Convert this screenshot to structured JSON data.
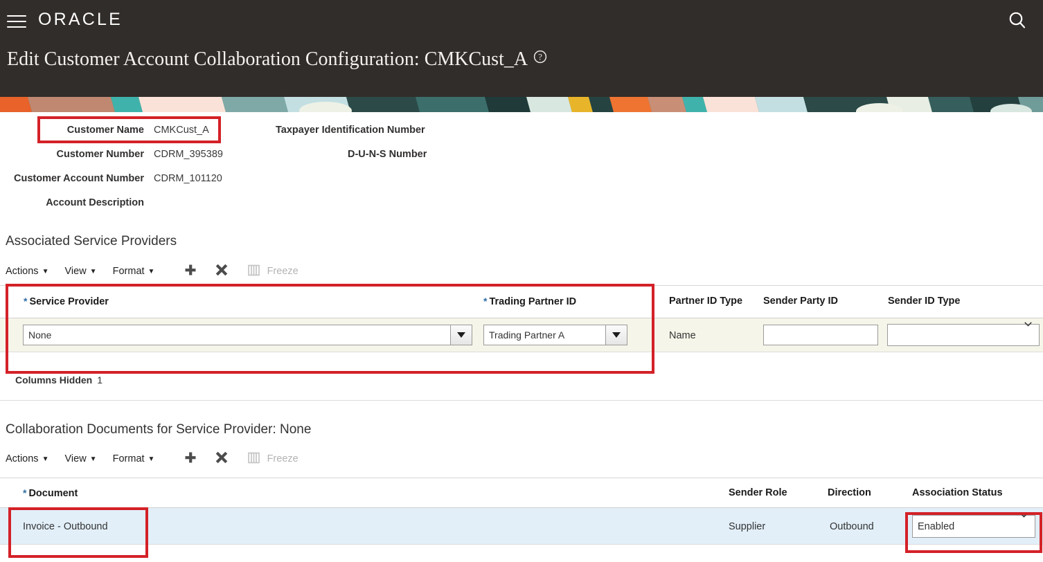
{
  "header": {
    "brand": "ORACLE",
    "menu_icon": "hamburger-icon",
    "search_icon": "search-icon",
    "title": "Edit Customer Account Collaboration Configuration: CMKCust_A",
    "help_icon": "help-circle-icon"
  },
  "summary": {
    "left": [
      {
        "label": "Customer Name",
        "value": "CMKCust_A"
      },
      {
        "label": "Customer Number",
        "value": "CDRM_395389"
      },
      {
        "label": "Customer Account Number",
        "value": "CDRM_101120"
      },
      {
        "label": "Account Description",
        "value": ""
      }
    ],
    "right": [
      {
        "label": "Taxpayer Identification Number",
        "value": ""
      },
      {
        "label": "D-U-N-S Number",
        "value": ""
      }
    ]
  },
  "providers_section": {
    "title": "Associated Service Providers",
    "toolbar": {
      "actions": "Actions",
      "view": "View",
      "format": "Format",
      "add_icon": "plus-icon",
      "delete_icon": "close-x-icon",
      "freeze_icon": "freeze-columns-icon",
      "freeze_label": "Freeze"
    },
    "columns": [
      {
        "label": "Service Provider",
        "required": true
      },
      {
        "label": "Trading Partner ID",
        "required": true
      },
      {
        "label": "Partner ID Type",
        "required": false
      },
      {
        "label": "Sender Party ID",
        "required": false
      },
      {
        "label": "Sender ID Type",
        "required": false
      }
    ],
    "row": {
      "service_provider": "None",
      "trading_partner_id": "Trading Partner A",
      "partner_id_type": "Name",
      "sender_party_id": "",
      "sender_party_id_placeholder": "",
      "sender_id_type": ""
    },
    "columns_hidden_label": "Columns Hidden",
    "columns_hidden_count": "1"
  },
  "documents_section": {
    "title": "Collaboration Documents for Service Provider: None",
    "toolbar": {
      "actions": "Actions",
      "view": "View",
      "format": "Format",
      "add_icon": "plus-icon",
      "delete_icon": "close-x-icon",
      "freeze_icon": "freeze-columns-icon",
      "freeze_label": "Freeze"
    },
    "columns": [
      {
        "label": "Document",
        "required": true
      },
      {
        "label": "Sender Role",
        "required": false
      },
      {
        "label": "Direction",
        "required": false
      },
      {
        "label": "Association Status",
        "required": false
      }
    ],
    "row": {
      "document": "Invoice - Outbound",
      "sender_role": "Supplier",
      "direction": "Outbound",
      "association_status": "Enabled"
    }
  },
  "colors": {
    "header_bg": "#312d2a",
    "annotation": "#d42128",
    "selected_row_ivory": "#f6f5e9",
    "selected_row_blue": "#e2eff9",
    "required_asterisk": "#2f6ea5"
  }
}
